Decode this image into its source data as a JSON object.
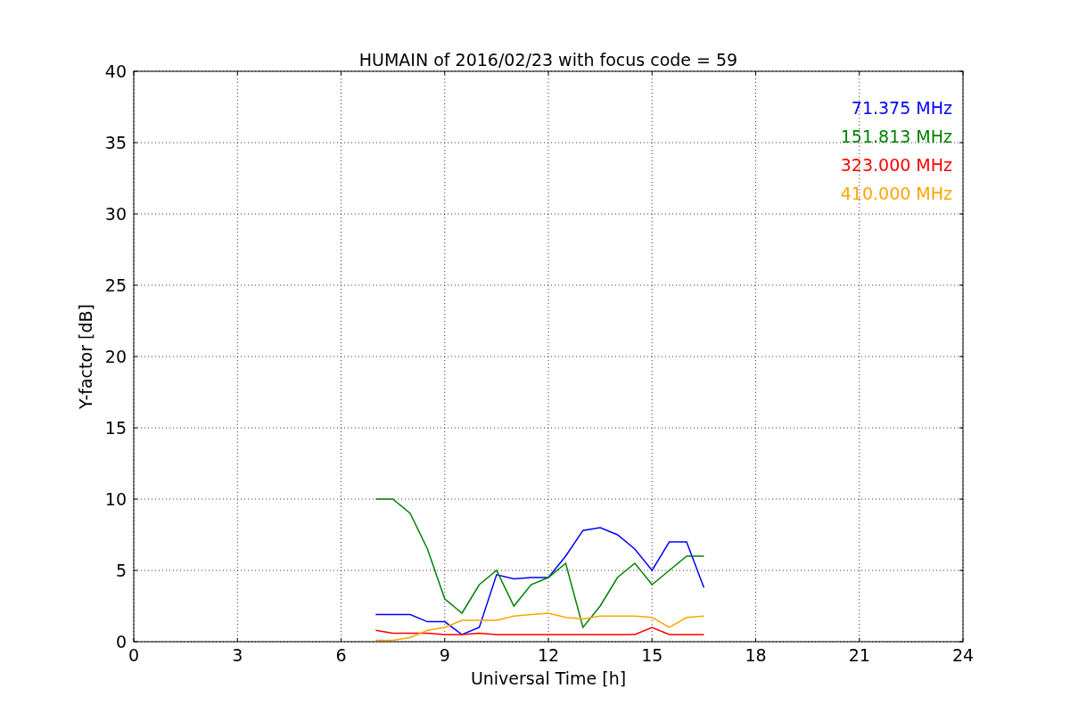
{
  "chart_data": {
    "type": "line",
    "title": "HUMAIN of 2016/02/23 with focus code = 59",
    "xlabel": "Universal Time [h]",
    "ylabel": "Y-factor [dB]",
    "x": [
      7,
      7.5,
      8,
      8.5,
      9,
      9.5,
      10,
      10.5,
      11,
      11.5,
      12,
      12.5,
      13,
      13.5,
      14,
      14.5,
      15,
      15.5,
      16,
      16.5
    ],
    "series": [
      {
        "name": "71.375 MHz",
        "color": "#0000ff",
        "values": [
          1.9,
          1.9,
          1.9,
          1.4,
          1.4,
          0.5,
          1.0,
          4.7,
          4.4,
          4.5,
          4.5,
          6.0,
          7.8,
          8.0,
          7.5,
          6.5,
          5.0,
          7.0,
          7.0,
          3.8
        ]
      },
      {
        "name": "151.813 MHz",
        "color": "#008000",
        "values": [
          10,
          10,
          9,
          6.5,
          3,
          2,
          4,
          5,
          2.5,
          4,
          4.5,
          5.5,
          1,
          2.5,
          4.5,
          5.5,
          4,
          5,
          6,
          6
        ]
      },
      {
        "name": "323.000 MHz",
        "color": "#ff0000",
        "values": [
          0.8,
          0.6,
          0.6,
          0.6,
          0.5,
          0.5,
          0.6,
          0.5,
          0.5,
          0.5,
          0.5,
          0.5,
          0.5,
          0.5,
          0.5,
          0.5,
          1.0,
          0.5,
          0.5,
          0.5
        ]
      },
      {
        "name": "410.000 MHz",
        "color": "#ffa500",
        "values": [
          0.1,
          0.1,
          0.3,
          0.8,
          1.0,
          1.5,
          1.5,
          1.5,
          1.8,
          1.9,
          2.0,
          1.7,
          1.6,
          1.8,
          1.8,
          1.8,
          1.7,
          1.0,
          1.7,
          1.8
        ]
      }
    ],
    "grid": true,
    "xlim": [
      0,
      24
    ],
    "ylim": [
      0,
      40
    ],
    "xticks": [
      0,
      3,
      6,
      9,
      12,
      15,
      18,
      21,
      24
    ],
    "yticks": [
      0,
      5,
      10,
      15,
      20,
      25,
      30,
      35,
      40
    ]
  }
}
